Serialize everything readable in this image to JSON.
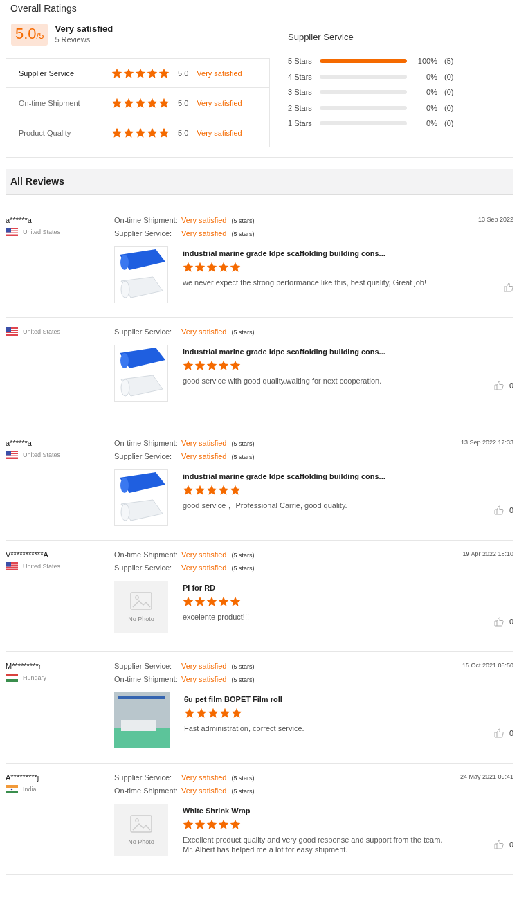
{
  "header": {
    "title": "Overall Ratings"
  },
  "summary": {
    "score": "5.0",
    "out_of": "/5",
    "verdict": "Very satisfied",
    "reviews": "5 Reviews"
  },
  "categories": [
    {
      "label": "Supplier Service",
      "stars": 5,
      "score": "5.0",
      "verdict": "Very satisfied",
      "selected": true
    },
    {
      "label": "On-time Shipment",
      "stars": 5,
      "score": "5.0",
      "verdict": "Very satisfied",
      "selected": false
    },
    {
      "label": "Product Quality",
      "stars": 5,
      "score": "5.0",
      "verdict": "Very satisfied",
      "selected": false
    }
  ],
  "distribution": {
    "title": "Supplier Service",
    "rows": [
      {
        "label": "5 Stars",
        "level": 1,
        "percent": "100%",
        "count": "(5)"
      },
      {
        "label": "4 Stars",
        "level": 0,
        "percent": "0%",
        "count": "(0)"
      },
      {
        "label": "3 Stars",
        "level": 0,
        "percent": "0%",
        "count": "(0)"
      },
      {
        "label": "2 Stars",
        "level": 0,
        "percent": "0%",
        "count": "(0)"
      },
      {
        "label": "1 Stars",
        "level": 0,
        "percent": "0%",
        "count": "(0)"
      }
    ]
  },
  "all_reviews": {
    "title": "All Reviews"
  },
  "reviews": [
    {
      "user": "a******a",
      "flag": {
        "kind": "us"
      },
      "country": "United States",
      "date": "13 Sep 2022",
      "criteria": [
        {
          "label": "On-time Shipment:",
          "verdict": "Very satisfied",
          "note": "(5 stars)"
        },
        {
          "label": "Supplier Service:",
          "verdict": "Very satisfied",
          "note": "(5 stars)"
        }
      ],
      "photo": {
        "kind": "rolls"
      },
      "product": "industrial marine grade ldpe scaffolding building cons...",
      "stars": 5,
      "text": "we never expect the strong performance like this, best quality, Great job!"
    },
    {
      "flag": {
        "kind": "us"
      },
      "country": "United States",
      "criteria": [
        {
          "label": "Supplier Service:",
          "verdict": "Very satisfied",
          "note": "(5 stars)"
        }
      ],
      "photo": {
        "kind": "rolls"
      },
      "product": "industrial marine grade ldpe scaffolding building cons...",
      "stars": 5,
      "text": "good service with good quality.waiting for next cooperation.",
      "likes": "0"
    },
    {
      "user": "a******a",
      "flag": {
        "kind": "us"
      },
      "country": "United States",
      "date": "13 Sep 2022 17:33",
      "criteria": [
        {
          "label": "On-time Shipment:",
          "verdict": "Very satisfied",
          "note": "(5 stars)"
        },
        {
          "label": "Supplier Service:",
          "verdict": "Very satisfied",
          "note": "(5 stars)"
        }
      ],
      "photo": {
        "kind": "rolls"
      },
      "product": "industrial marine grade ldpe scaffolding building cons...",
      "stars": 5,
      "text": "good service，  Professional Carrie, good quality.",
      "likes": "0"
    },
    {
      "user": "V***********A",
      "flag": {
        "kind": "us"
      },
      "country": "United States",
      "date": "19 Apr 2022 18:10",
      "criteria": [
        {
          "label": "On-time Shipment:",
          "verdict": "Very satisfied",
          "note": "(5 stars)"
        },
        {
          "label": "Supplier Service:",
          "verdict": "Very satisfied",
          "note": "(5 stars)"
        }
      ],
      "photo": {
        "kind": "none",
        "label": "No Photo"
      },
      "product": "PI for RD",
      "stars": 5,
      "text": "excelente product!!!",
      "likes": "0"
    },
    {
      "user": "M*********r",
      "flag": {
        "kind": "hu"
      },
      "country": "Hungary",
      "date": "15 Oct 2021 05:50",
      "criteria": [
        {
          "label": "Supplier Service:",
          "verdict": "Very satisfied",
          "note": "(5 stars)"
        },
        {
          "label": "On-time Shipment:",
          "verdict": "Very satisfied",
          "note": "(5 stars)"
        }
      ],
      "photo": {
        "kind": "factory"
      },
      "product": "6u pet film BOPET Film roll",
      "stars": 5,
      "text": "Fast administration, correct service.",
      "likes": "0"
    },
    {
      "user": "A*********j",
      "flag": {
        "kind": "in"
      },
      "country": "India",
      "date": "24 May 2021 09:41",
      "criteria": [
        {
          "label": "Supplier Service:",
          "verdict": "Very satisfied",
          "note": "(5 stars)"
        },
        {
          "label": "On-time Shipment:",
          "verdict": "Very satisfied",
          "note": "(5 stars)"
        }
      ],
      "photo": {
        "kind": "none",
        "label": "No Photo"
      },
      "product": "White Shrink Wrap",
      "stars": 5,
      "text": "Excellent product quality and very good response and support from the team. Mr. Albert has helped me a lot for easy shipment.",
      "likes": "0"
    }
  ]
}
